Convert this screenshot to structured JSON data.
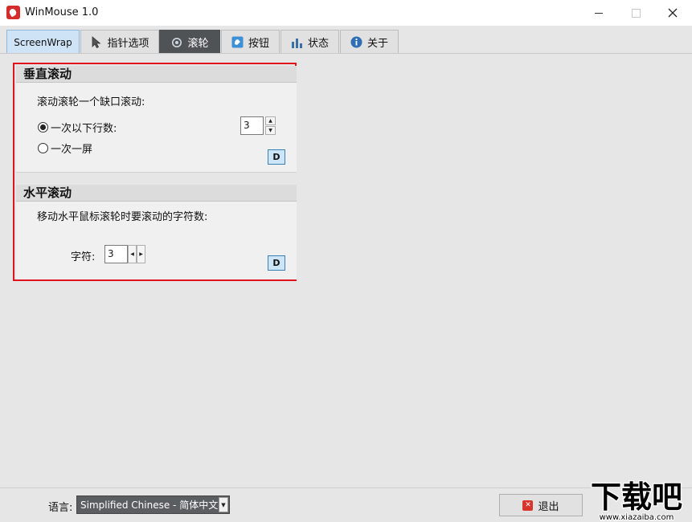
{
  "window": {
    "title": "WinMouse 1.0"
  },
  "tabs": [
    {
      "label": "ScreenWrap",
      "icon": "none",
      "active": false
    },
    {
      "label": "指针选项",
      "icon": "pointer-icon",
      "active": false
    },
    {
      "label": "滚轮",
      "icon": "wheel-icon",
      "active": true
    },
    {
      "label": "按钮",
      "icon": "button-icon",
      "active": false
    },
    {
      "label": "状态",
      "icon": "bar-chart-icon",
      "active": false
    },
    {
      "label": "关于",
      "icon": "info-icon",
      "active": false
    }
  ],
  "vertical": {
    "header": "垂直滚动",
    "description": "滚动滚轮一个缺口滚动:",
    "option_lines": "一次以下行数:",
    "option_screen": "一次一屏",
    "selected_option": "lines",
    "lines_value": "3",
    "default_label": "D"
  },
  "horizontal": {
    "header": "水平滚动",
    "description": "移动水平鼠标滚轮时要滚动的字符数:",
    "chars_label": "字符:",
    "chars_value": "3",
    "default_label": "D"
  },
  "footer": {
    "language_label": "语言:",
    "language_value": "Simplified Chinese  -  简体中文",
    "exit_label": "退出"
  },
  "watermark": {
    "main": "下载吧",
    "url": "www.xiazaiba.com"
  },
  "colors": {
    "active_tab": "#4f5356",
    "screenwrap_tab": "#cfe3f7",
    "highlight_border": "#e0141c",
    "d_button": "#cde5f8",
    "exit_icon": "#d9342b"
  }
}
